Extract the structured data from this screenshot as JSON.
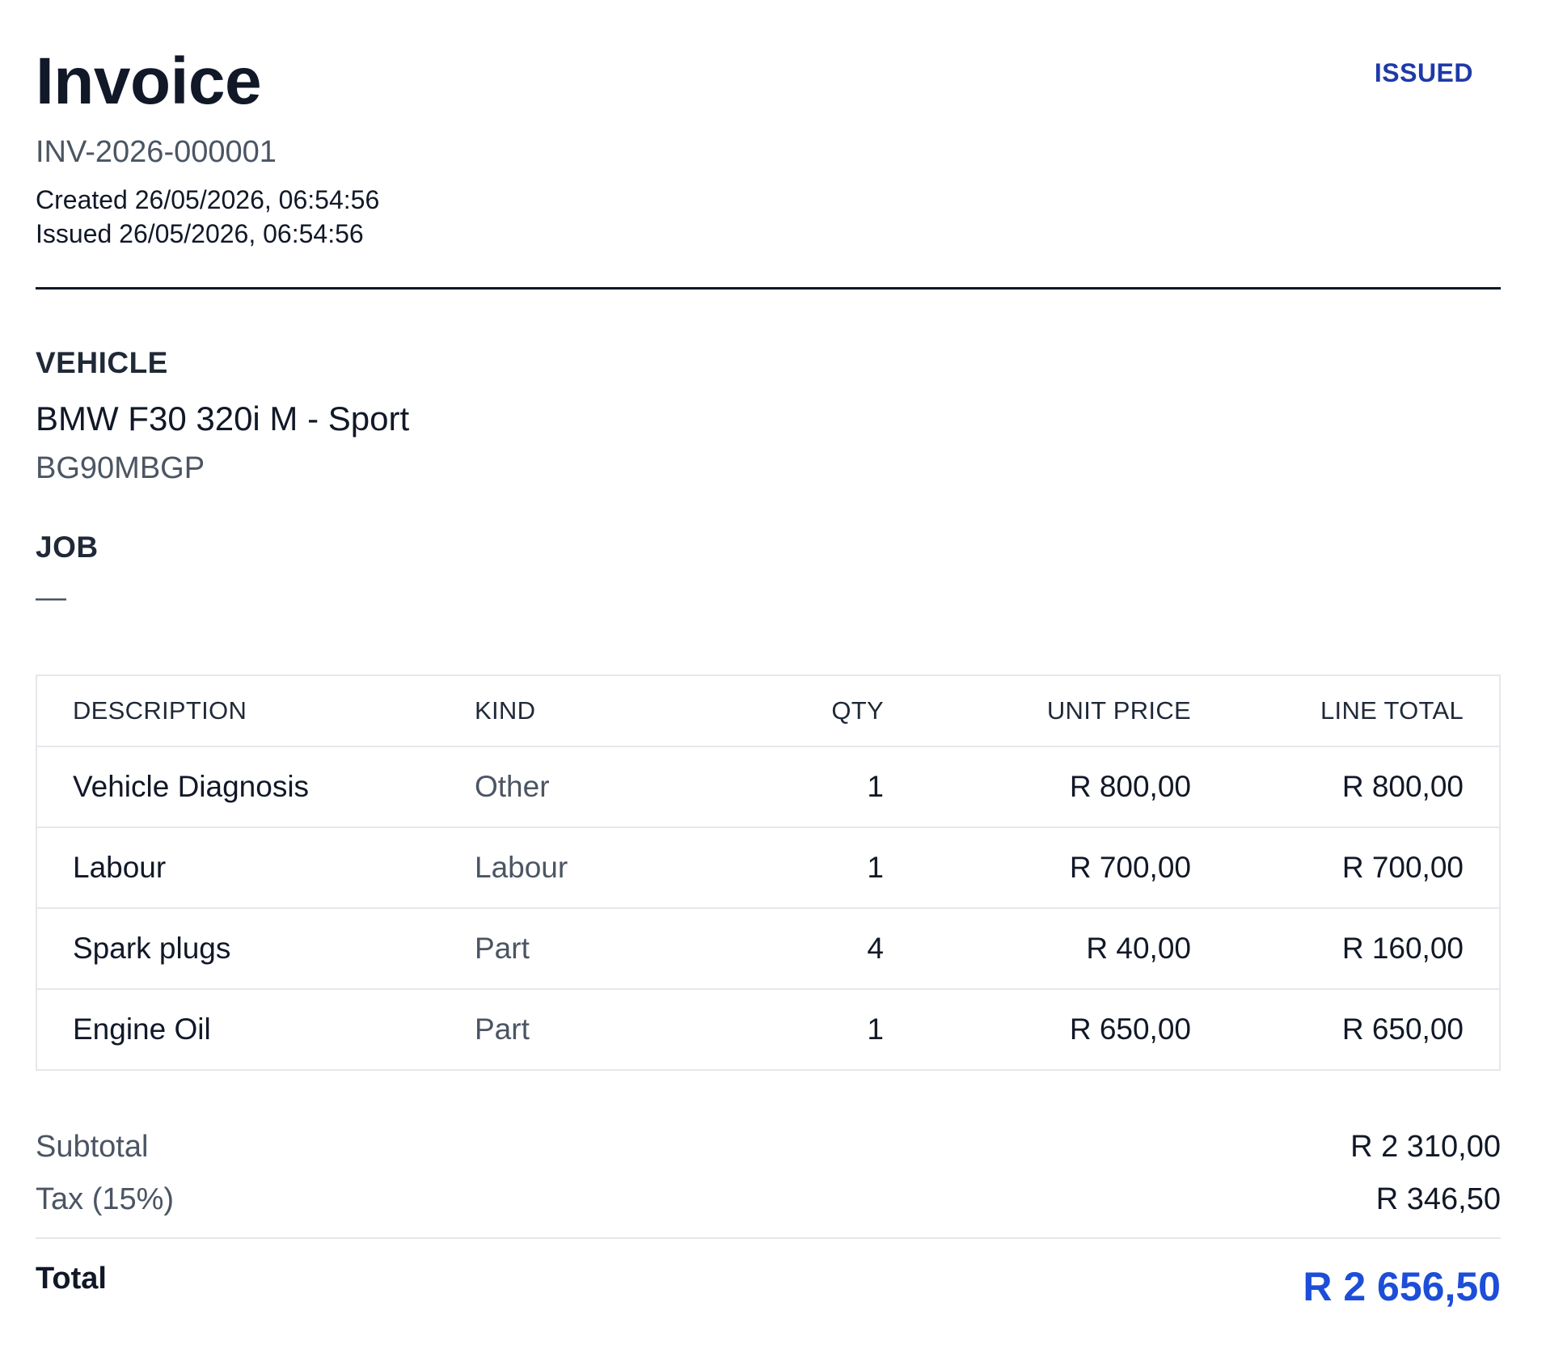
{
  "invoice": {
    "title": "Invoice",
    "status": "ISSUED",
    "number": "INV-2026-000001",
    "created": "Created 26/05/2026, 06:54:56",
    "issued": "Issued 26/05/2026, 06:54:56"
  },
  "vehicle": {
    "label": "VEHICLE",
    "name": "BMW F30 320i M - Sport",
    "registration": "BG90MBGP"
  },
  "job": {
    "label": "JOB",
    "value": "—"
  },
  "table": {
    "headers": {
      "description": "DESCRIPTION",
      "kind": "KIND",
      "qty": "QTY",
      "unit_price": "UNIT PRICE",
      "line_total": "LINE TOTAL"
    },
    "rows": [
      {
        "description": "Vehicle Diagnosis",
        "kind": "Other",
        "qty": "1",
        "unit_price": "R 800,00",
        "line_total": "R 800,00"
      },
      {
        "description": "Labour",
        "kind": "Labour",
        "qty": "1",
        "unit_price": "R 700,00",
        "line_total": "R 700,00"
      },
      {
        "description": "Spark plugs",
        "kind": "Part",
        "qty": "4",
        "unit_price": "R 40,00",
        "line_total": "R 160,00"
      },
      {
        "description": "Engine Oil",
        "kind": "Part",
        "qty": "1",
        "unit_price": "R 650,00",
        "line_total": "R 650,00"
      }
    ]
  },
  "totals": {
    "subtotal_label": "Subtotal",
    "subtotal_value": "R 2 310,00",
    "tax_label": "Tax (15%)",
    "tax_value": "R 346,50",
    "total_label": "Total",
    "total_value": "R 2 656,50"
  },
  "colors": {
    "status": "#1e3aa8",
    "total_accent": "#1d4ed8",
    "muted_text": "#4b5563",
    "border": "#e5e7eb"
  }
}
